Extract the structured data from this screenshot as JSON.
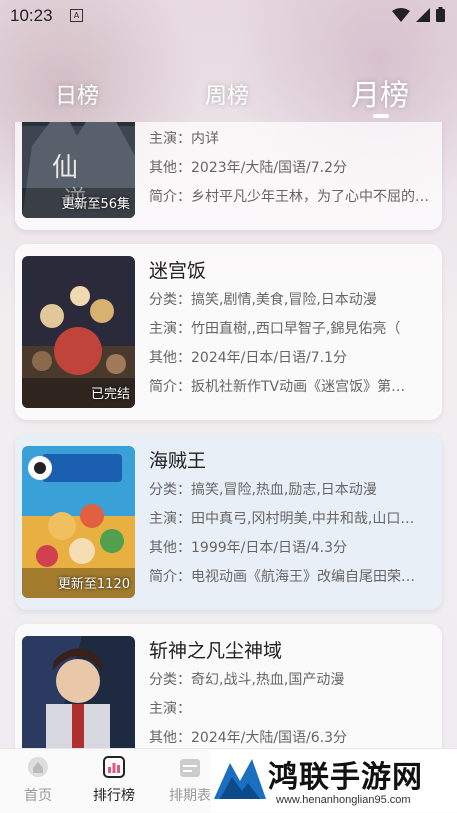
{
  "status_bar": {
    "time": "10:23",
    "notification_badge": "A",
    "icons": [
      "wifi-icon",
      "signal-icon",
      "battery-icon"
    ]
  },
  "tabs": [
    {
      "label": "日榜",
      "active": false
    },
    {
      "label": "周榜",
      "active": false
    },
    {
      "label": "月榜",
      "active": true
    }
  ],
  "items": [
    {
      "title": "",
      "badge": "更新至56集",
      "category": "",
      "cast": "主演：内详",
      "other": "其他：2023年/大陆/国语/7.2分",
      "intro": "简介：乡村平凡少年王林，为了心中不屈的信念，一步步踏入修仙之路"
    },
    {
      "title": "迷宫饭",
      "badge": "已完结",
      "category": "分类：搞笑,剧情,美食,冒险,日本动漫",
      "cast": "主演：竹田直樹,,西口早智子,錦見佑亮（",
      "other": "其他：2024年/日本/日语/7.1分",
      "intro": "简介：扳机社新作TV动画《迷宫饭》第…"
    },
    {
      "title": "海贼王",
      "badge": "更新至1120",
      "category": "分类：搞笑,冒险,热血,励志,日本动漫",
      "cast": "主演：田中真弓,冈村明美,中井和哉,山口…",
      "other": "其他：1999年/日本/日语/4.3分",
      "intro": "简介：电视动画《航海王》改编自尾田荣…"
    },
    {
      "title": "斩神之凡尘神域",
      "badge": "",
      "category": "分类：奇幻,战斗,热血,国产动漫",
      "cast": "主演：",
      "other": "其他：2024年/大陆/国语/6.3分",
      "intro": ""
    }
  ],
  "bottom_nav": [
    {
      "label": "首页",
      "icon": "home-icon",
      "active": false
    },
    {
      "label": "排行榜",
      "icon": "ranking-icon",
      "active": true
    },
    {
      "label": "排期表",
      "icon": "calendar-icon",
      "active": false
    }
  ],
  "watermark": {
    "text": "鸿联手游网",
    "url": "www.henanhonglian95.com"
  },
  "colors": {
    "accent": "#e05a7a",
    "text_primary": "#222222",
    "text_secondary": "#666666",
    "card_alt_bg": "#e8eef6"
  }
}
